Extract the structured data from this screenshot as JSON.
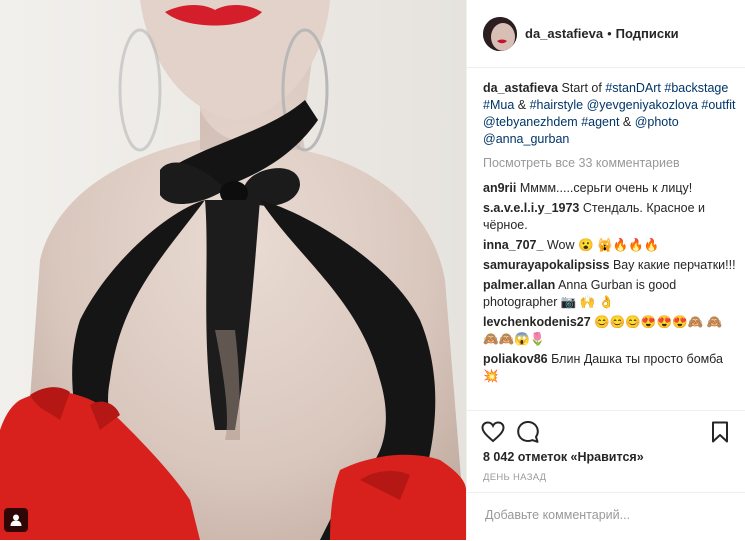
{
  "post": {
    "username": "da_astafieva",
    "separator": "•",
    "follow_label": "Подписки",
    "caption": {
      "author": "da_astafieva",
      "text_1": "Start of ",
      "tag_1": "#stanDArt",
      "tag_2": "#backstage",
      "tag_3": "#Mua",
      "amp_1": " & ",
      "tag_4": "#hairstyle",
      "tag_5": "@yevgeniyakozlova",
      "tag_6": "#outfit",
      "tag_7": "@tebyanezhdem",
      "tag_8": "#agent",
      "amp_2": " & ",
      "tag_9": "@photo",
      "tag_10": "@anna_gurban"
    },
    "view_all": "Посмотреть все 33 комментариев",
    "comments": [
      {
        "user": "an9rii",
        "text": "Мммм.....серьги очень к лицу!"
      },
      {
        "user": "s.a.v.e.l.i.y_1973",
        "text": "Стендаль. Красное и чёрное."
      },
      {
        "user": "inna_707_",
        "text": "Wow 😮 🙀🔥🔥🔥"
      },
      {
        "user": "samurayapokalipsiss",
        "text": "Вау какие перчатки!!!"
      },
      {
        "user": "palmer.allan",
        "text": "Anna Gurban is good photographer 📷 🙌 👌"
      },
      {
        "user": "levchenkodenis27",
        "text": "😊😊😊😍😍😍🙈 🙈🙈🙈😱🌷"
      },
      {
        "user": "poliakov86",
        "text": "Блин Дашка ты просто бомба 💥"
      }
    ],
    "likes": "8 042 отметок «Нравится»",
    "time": "ДЕНЬ НАЗАД",
    "add_comment_placeholder": "Добавьте комментарий...",
    "icons": {
      "like": "heart-icon",
      "comment": "comment-bubble-icon",
      "save": "bookmark-icon",
      "tagged_user": "user-tag-icon"
    },
    "colors": {
      "link": "#003569",
      "muted": "#999999",
      "text": "#262626",
      "glove_red": "#d8211d",
      "scarf_black": "#141414"
    }
  }
}
